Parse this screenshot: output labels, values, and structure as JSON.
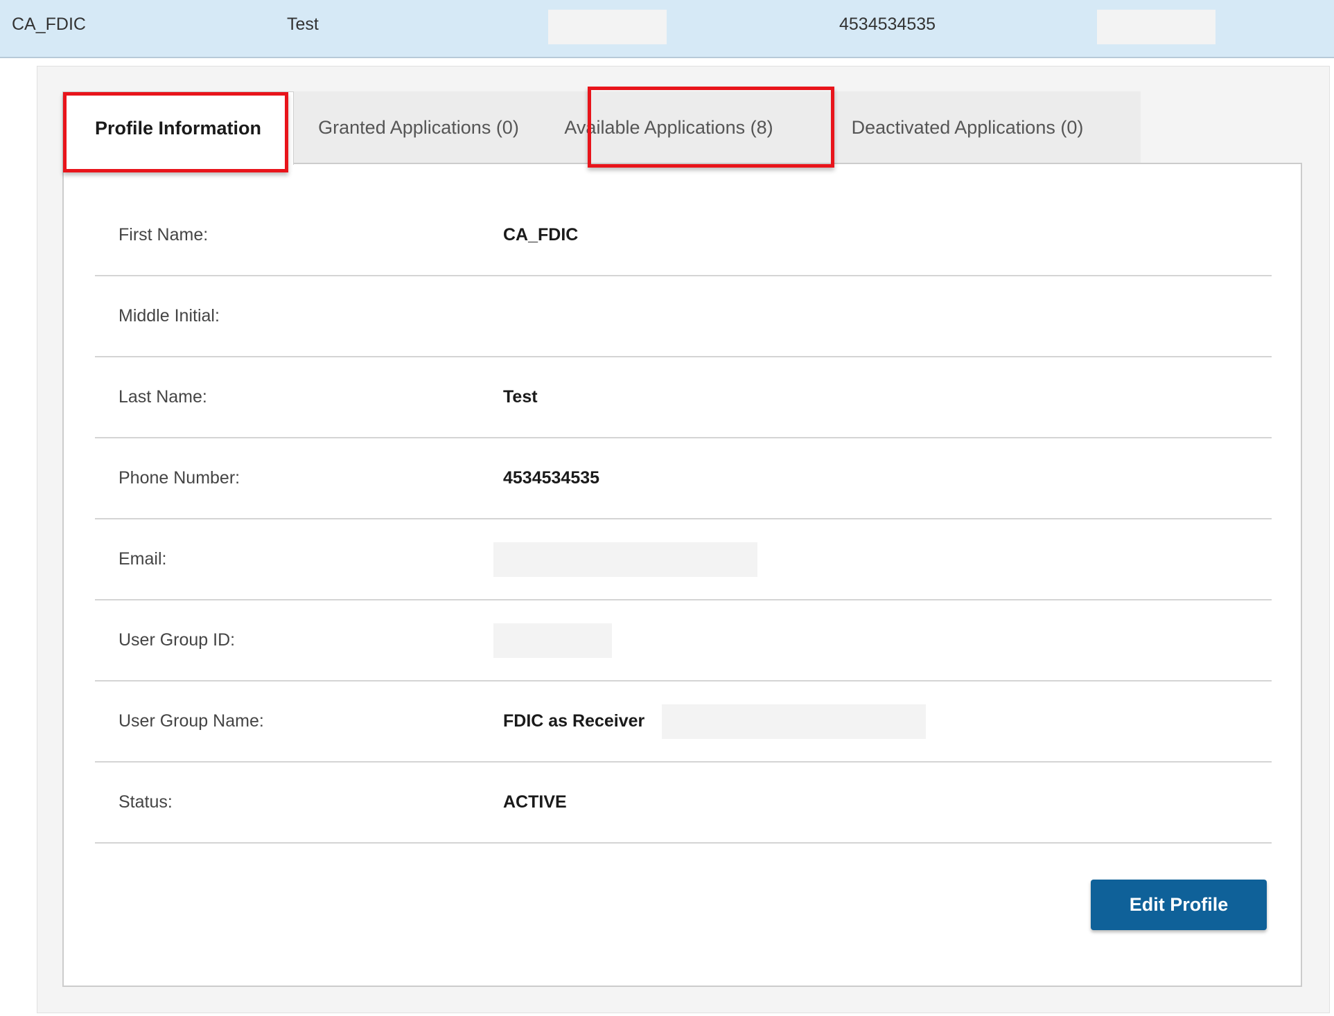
{
  "summary": {
    "first_name": "CA_FDIC",
    "last_name": "Test",
    "phone": "4534534535"
  },
  "tabs": [
    {
      "label": "Profile Information",
      "active": true,
      "highlighted": true
    },
    {
      "label": "Granted Applications (0)",
      "active": false,
      "highlighted": false
    },
    {
      "label": "Available Applications (8)",
      "active": false,
      "highlighted": true
    },
    {
      "label": "Deactivated Applications (0)",
      "active": false,
      "highlighted": false
    }
  ],
  "profile": {
    "fields": [
      {
        "label": "First Name:",
        "value": "CA_FDIC"
      },
      {
        "label": "Middle Initial:",
        "value": ""
      },
      {
        "label": "Last Name:",
        "value": "Test"
      },
      {
        "label": "Phone Number:",
        "value": "4534534535"
      },
      {
        "label": "Email:",
        "value": ""
      },
      {
        "label": "User Group ID:",
        "value": ""
      },
      {
        "label": "User Group Name:",
        "value": "FDIC as Receiver"
      },
      {
        "label": "Status:",
        "value": "ACTIVE"
      }
    ]
  },
  "actions": {
    "edit_profile_label": "Edit Profile"
  },
  "colors": {
    "summary_background": "#d6e9f6",
    "highlight": "#e8141b",
    "primary_button": "#0f6199"
  }
}
